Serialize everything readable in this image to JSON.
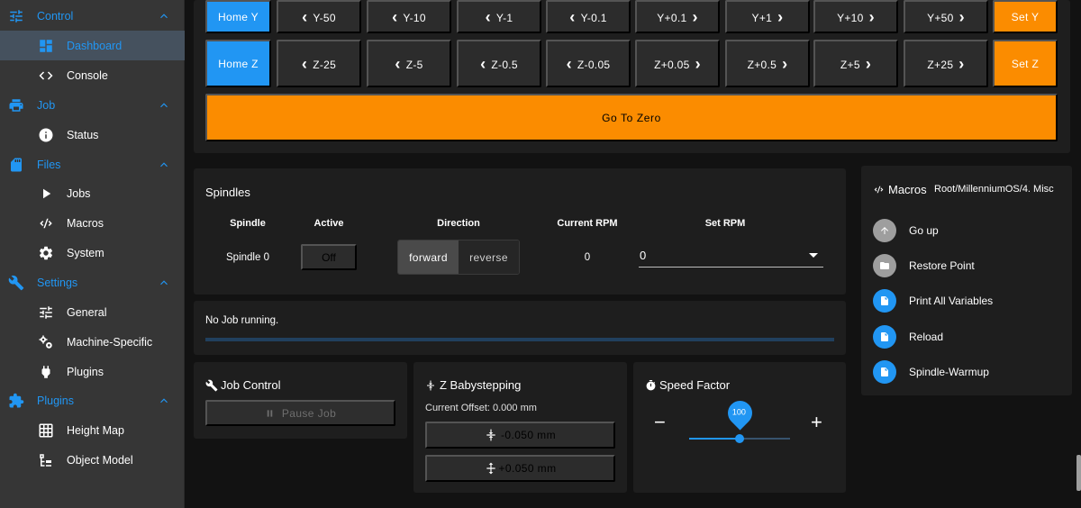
{
  "sidebar": {
    "groups": [
      {
        "label": "Control",
        "icon": "sliders-icon",
        "items": [
          {
            "label": "Dashboard",
            "icon": "dashboard-icon",
            "active": true
          },
          {
            "label": "Console",
            "icon": "code-icon"
          }
        ]
      },
      {
        "label": "Job",
        "icon": "printer-icon",
        "items": [
          {
            "label": "Status",
            "icon": "info-icon"
          }
        ]
      },
      {
        "label": "Files",
        "icon": "sd-card-icon",
        "items": [
          {
            "label": "Jobs",
            "icon": "play-icon"
          },
          {
            "label": "Macros",
            "icon": "macro-icon"
          },
          {
            "label": "System",
            "icon": "gear-icon"
          }
        ]
      },
      {
        "label": "Settings",
        "icon": "wrench-icon",
        "items": [
          {
            "label": "General",
            "icon": "tune-icon"
          },
          {
            "label": "Machine-Specific",
            "icon": "cogs-icon"
          },
          {
            "label": "Plugins",
            "icon": "plug-icon"
          }
        ]
      },
      {
        "label": "Plugins",
        "icon": "puzzle-icon",
        "items": [
          {
            "label": "Height Map",
            "icon": "grid-icon"
          },
          {
            "label": "Object Model",
            "icon": "tree-icon"
          }
        ]
      }
    ]
  },
  "jog": {
    "row_y": {
      "home": "Home Y",
      "steps": [
        "Y-50",
        "Y-10",
        "Y-1",
        "Y-0.1",
        "Y+0.1",
        "Y+1",
        "Y+10",
        "Y+50"
      ],
      "set": "Set Y"
    },
    "row_z": {
      "home": "Home Z",
      "steps": [
        "Z-25",
        "Z-5",
        "Z-0.5",
        "Z-0.05",
        "Z+0.05",
        "Z+0.5",
        "Z+5",
        "Z+25"
      ],
      "set": "Set Z"
    },
    "go_to_zero": "Go To Zero"
  },
  "spindles": {
    "title": "Spindles",
    "headers": {
      "spindle": "Spindle",
      "active": "Active",
      "direction": "Direction",
      "current_rpm": "Current RPM",
      "set_rpm": "Set RPM"
    },
    "row": {
      "name": "Spindle 0",
      "active": "Off",
      "direction_forward": "forward",
      "direction_reverse": "reverse",
      "current_rpm": "0",
      "set_rpm": "0"
    }
  },
  "job_status": {
    "text": "No Job running."
  },
  "job_control": {
    "title": "Job Control",
    "pause_label": "Pause Job"
  },
  "babystepping": {
    "title": "Z Babystepping",
    "offset": "Current Offset: 0.000 mm",
    "minus": "-0.050 mm",
    "plus": "+0.050 mm"
  },
  "speed_factor": {
    "title": "Speed Factor",
    "value": "100",
    "value_num": 100,
    "min": 50,
    "max": 150,
    "minus": "−",
    "plus": "+"
  },
  "macros": {
    "title": "Macros",
    "path": "Root/MillenniumOS/4. Misc",
    "items": [
      {
        "label": "Go up",
        "icon": "arrow-up-icon",
        "kind": "nav"
      },
      {
        "label": "Restore Point",
        "icon": "folder-icon",
        "kind": "folder"
      },
      {
        "label": "Print All Variables",
        "icon": "file-icon",
        "kind": "file"
      },
      {
        "label": "Reload",
        "icon": "file-icon",
        "kind": "file"
      },
      {
        "label": "Spindle-Warmup",
        "icon": "file-icon",
        "kind": "file"
      }
    ]
  },
  "colors": {
    "accent": "#2196f3",
    "orange": "#fb8c00",
    "panel": "#1e1e1e",
    "sidebar": "#363636"
  }
}
